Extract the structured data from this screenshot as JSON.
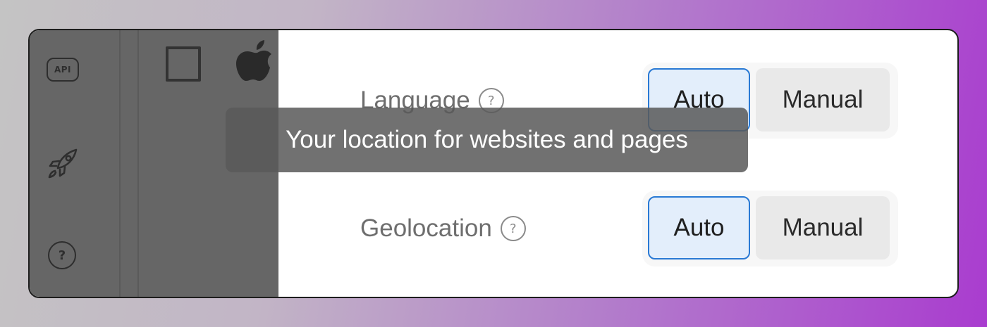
{
  "rail": {
    "api_label": "API",
    "help_glyph": "?"
  },
  "settings": {
    "language": {
      "label": "Language",
      "help_glyph": "?",
      "options": [
        "Auto",
        "Manual"
      ],
      "selected": "Auto"
    },
    "geolocation": {
      "label": "Geolocation",
      "help_glyph": "?",
      "options": [
        "Auto",
        "Manual"
      ],
      "selected": "Auto"
    }
  },
  "tooltip": {
    "text": "Your location for websites and pages"
  },
  "icons": [
    "api-icon",
    "rocket-icon",
    "help-icon",
    "checkbox-icon",
    "apple-icon",
    "question-icon"
  ],
  "colors": {
    "selected_border": "#2979d4",
    "selected_fill": "#e3eefb",
    "overlay": "#666666"
  }
}
